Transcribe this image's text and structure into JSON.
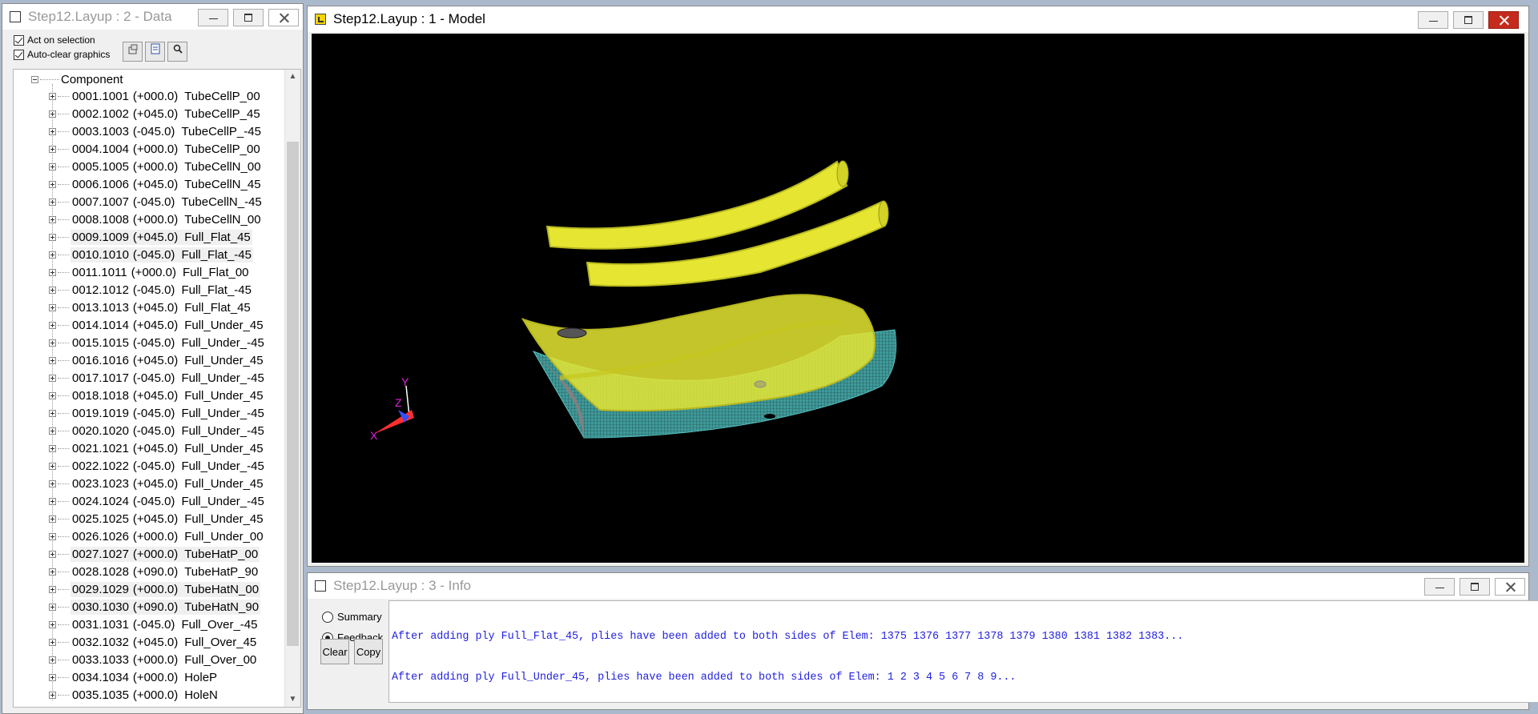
{
  "data_window": {
    "title": "Step12.Layup : 2 - Data",
    "options": [
      {
        "label": "Act on selection",
        "checked": true
      },
      {
        "label": "Auto-clear graphics",
        "checked": true
      }
    ],
    "toolbar_icons": [
      "properties-icon",
      "list-icon",
      "search-icon"
    ],
    "tree": {
      "root_label": "Component",
      "items": [
        {
          "id": "0001.1001",
          "angle": "(+000.0)",
          "name": "TubeCellP_00",
          "hl": false
        },
        {
          "id": "0002.1002",
          "angle": "(+045.0)",
          "name": "TubeCellP_45",
          "hl": false
        },
        {
          "id": "0003.1003",
          "angle": "(-045.0)",
          "name": "TubeCellP_-45",
          "hl": false
        },
        {
          "id": "0004.1004",
          "angle": "(+000.0)",
          "name": "TubeCellP_00",
          "hl": false
        },
        {
          "id": "0005.1005",
          "angle": "(+000.0)",
          "name": "TubeCellN_00",
          "hl": false
        },
        {
          "id": "0006.1006",
          "angle": "(+045.0)",
          "name": "TubeCellN_45",
          "hl": false
        },
        {
          "id": "0007.1007",
          "angle": "(-045.0)",
          "name": "TubeCellN_-45",
          "hl": false
        },
        {
          "id": "0008.1008",
          "angle": "(+000.0)",
          "name": "TubeCellN_00",
          "hl": false
        },
        {
          "id": "0009.1009",
          "angle": "(+045.0)",
          "name": "Full_Flat_45",
          "hl": true
        },
        {
          "id": "0010.1010",
          "angle": "(-045.0)",
          "name": "Full_Flat_-45",
          "hl": true
        },
        {
          "id": "0011.1011",
          "angle": "(+000.0)",
          "name": "Full_Flat_00",
          "hl": false
        },
        {
          "id": "0012.1012",
          "angle": "(-045.0)",
          "name": "Full_Flat_-45",
          "hl": false
        },
        {
          "id": "0013.1013",
          "angle": "(+045.0)",
          "name": "Full_Flat_45",
          "hl": false
        },
        {
          "id": "0014.1014",
          "angle": "(+045.0)",
          "name": "Full_Under_45",
          "hl": false
        },
        {
          "id": "0015.1015",
          "angle": "(-045.0)",
          "name": "Full_Under_-45",
          "hl": false
        },
        {
          "id": "0016.1016",
          "angle": "(+045.0)",
          "name": "Full_Under_45",
          "hl": false
        },
        {
          "id": "0017.1017",
          "angle": "(-045.0)",
          "name": "Full_Under_-45",
          "hl": false
        },
        {
          "id": "0018.1018",
          "angle": "(+045.0)",
          "name": "Full_Under_45",
          "hl": false
        },
        {
          "id": "0019.1019",
          "angle": "(-045.0)",
          "name": "Full_Under_-45",
          "hl": false
        },
        {
          "id": "0020.1020",
          "angle": "(-045.0)",
          "name": "Full_Under_-45",
          "hl": false
        },
        {
          "id": "0021.1021",
          "angle": "(+045.0)",
          "name": "Full_Under_45",
          "hl": false
        },
        {
          "id": "0022.1022",
          "angle": "(-045.0)",
          "name": "Full_Under_-45",
          "hl": false
        },
        {
          "id": "0023.1023",
          "angle": "(+045.0)",
          "name": "Full_Under_45",
          "hl": false
        },
        {
          "id": "0024.1024",
          "angle": "(-045.0)",
          "name": "Full_Under_-45",
          "hl": false
        },
        {
          "id": "0025.1025",
          "angle": "(+045.0)",
          "name": "Full_Under_45",
          "hl": false
        },
        {
          "id": "0026.1026",
          "angle": "(+000.0)",
          "name": "Full_Under_00",
          "hl": false
        },
        {
          "id": "0027.1027",
          "angle": "(+000.0)",
          "name": "TubeHatP_00",
          "hl": true
        },
        {
          "id": "0028.1028",
          "angle": "(+090.0)",
          "name": "TubeHatP_90",
          "hl": false
        },
        {
          "id": "0029.1029",
          "angle": "(+000.0)",
          "name": "TubeHatN_00",
          "hl": true
        },
        {
          "id": "0030.1030",
          "angle": "(+090.0)",
          "name": "TubeHatN_90",
          "hl": true
        },
        {
          "id": "0031.1031",
          "angle": "(-045.0)",
          "name": "Full_Over_-45",
          "hl": false
        },
        {
          "id": "0032.1032",
          "angle": "(+045.0)",
          "name": "Full_Over_45",
          "hl": false
        },
        {
          "id": "0033.1033",
          "angle": "(+000.0)",
          "name": "Full_Over_00",
          "hl": false
        },
        {
          "id": "0034.1034",
          "angle": "(+000.0)",
          "name": "HoleP",
          "hl": false
        },
        {
          "id": "0035.1035",
          "angle": "(+000.0)",
          "name": "HoleN",
          "hl": false
        }
      ]
    }
  },
  "model_window": {
    "title": "Step12.Layup : 1 - Model",
    "axes": {
      "x": "X",
      "y": "Y",
      "z": "Z"
    },
    "colors": {
      "ply_yellow": "#e6e632",
      "mesh_teal": "#4aa8a8",
      "background": "#000000"
    }
  },
  "info_window": {
    "title": "Step12.Layup : 3 - Info",
    "modes": [
      {
        "label": "Summary",
        "selected": false
      },
      {
        "label": "Feedback",
        "selected": true
      }
    ],
    "buttons": {
      "clear": "Clear",
      "copy": "Copy"
    },
    "log_lines": [
      "After adding ply Full_Flat_45, plies have been added to both sides of Elem: 1375 1376 1377 1378 1379 1380 1381 1382 1383...",
      "After adding ply Full_Under_45, plies have been added to both sides of Elem: 1 2 3 4 5 6 7 8 9..."
    ]
  }
}
